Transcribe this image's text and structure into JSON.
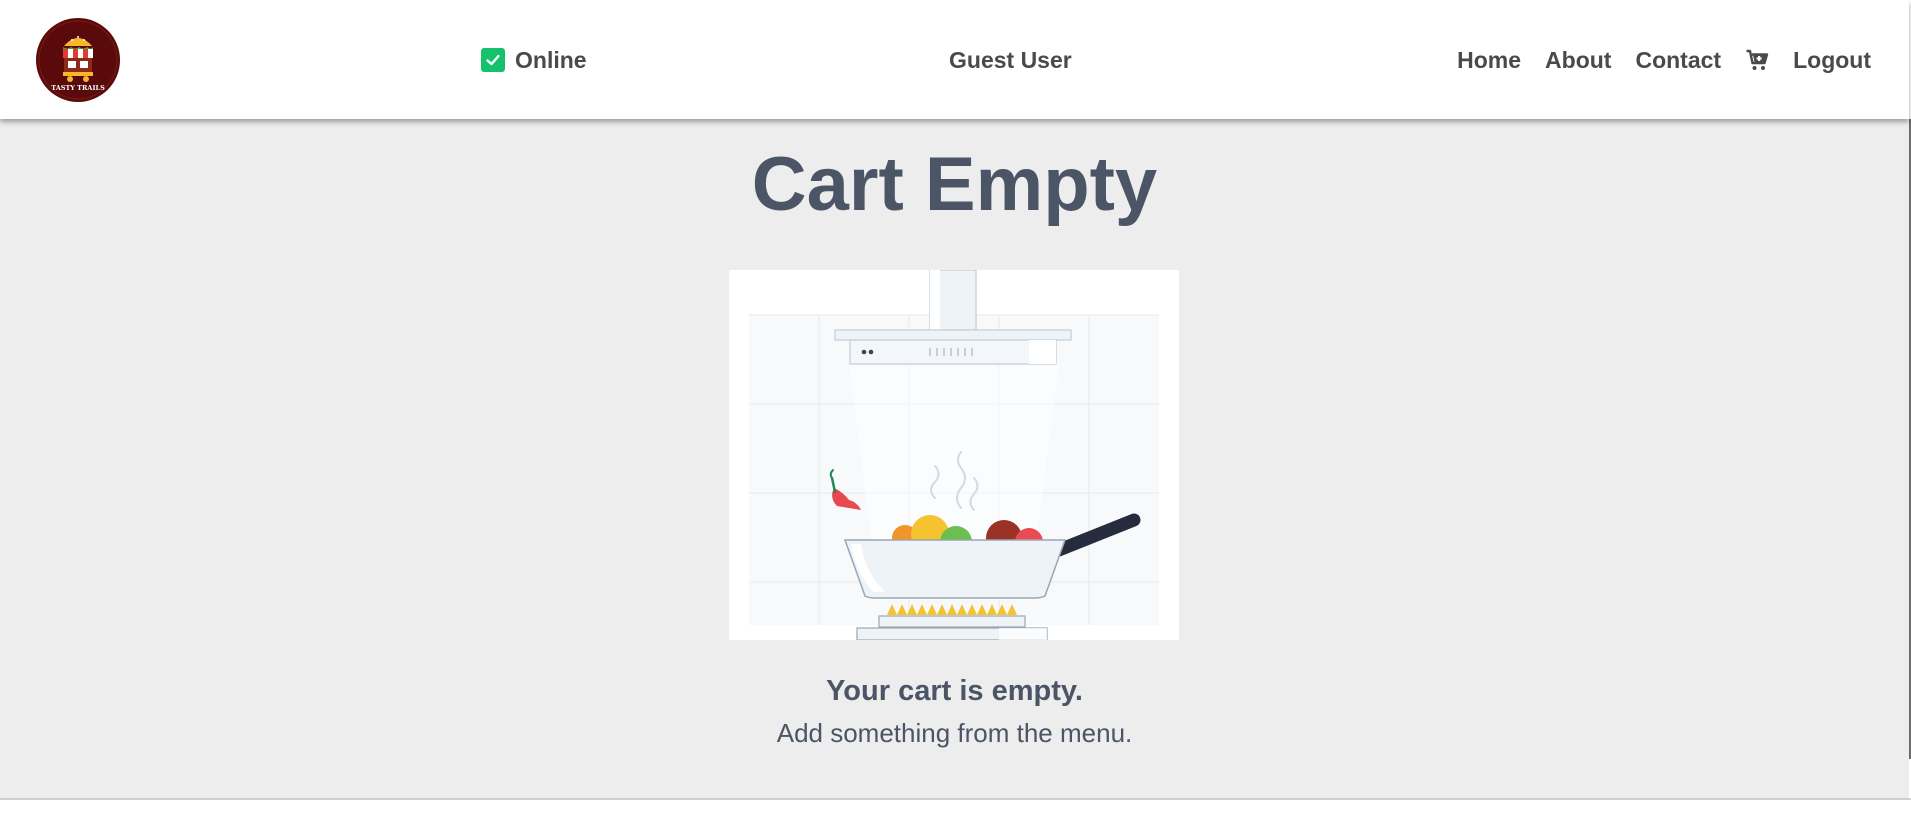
{
  "header": {
    "logo_text": "TASTY TRAILS",
    "status_label": "Online",
    "user_label": "Guest User",
    "nav": {
      "home": "Home",
      "about": "About",
      "contact": "Contact",
      "logout": "Logout"
    },
    "icons": {
      "status": "checkbox-checked-icon",
      "cart": "cart-icon"
    }
  },
  "main": {
    "title": "Cart Empty",
    "message_heading": "Your cart is empty.",
    "message_sub": "Add something from the menu."
  },
  "colors": {
    "online_green": "#15c26b",
    "heading_slate": "#4b5566",
    "page_background": "#ededed",
    "logo_maroon": "#5a0a0a"
  }
}
